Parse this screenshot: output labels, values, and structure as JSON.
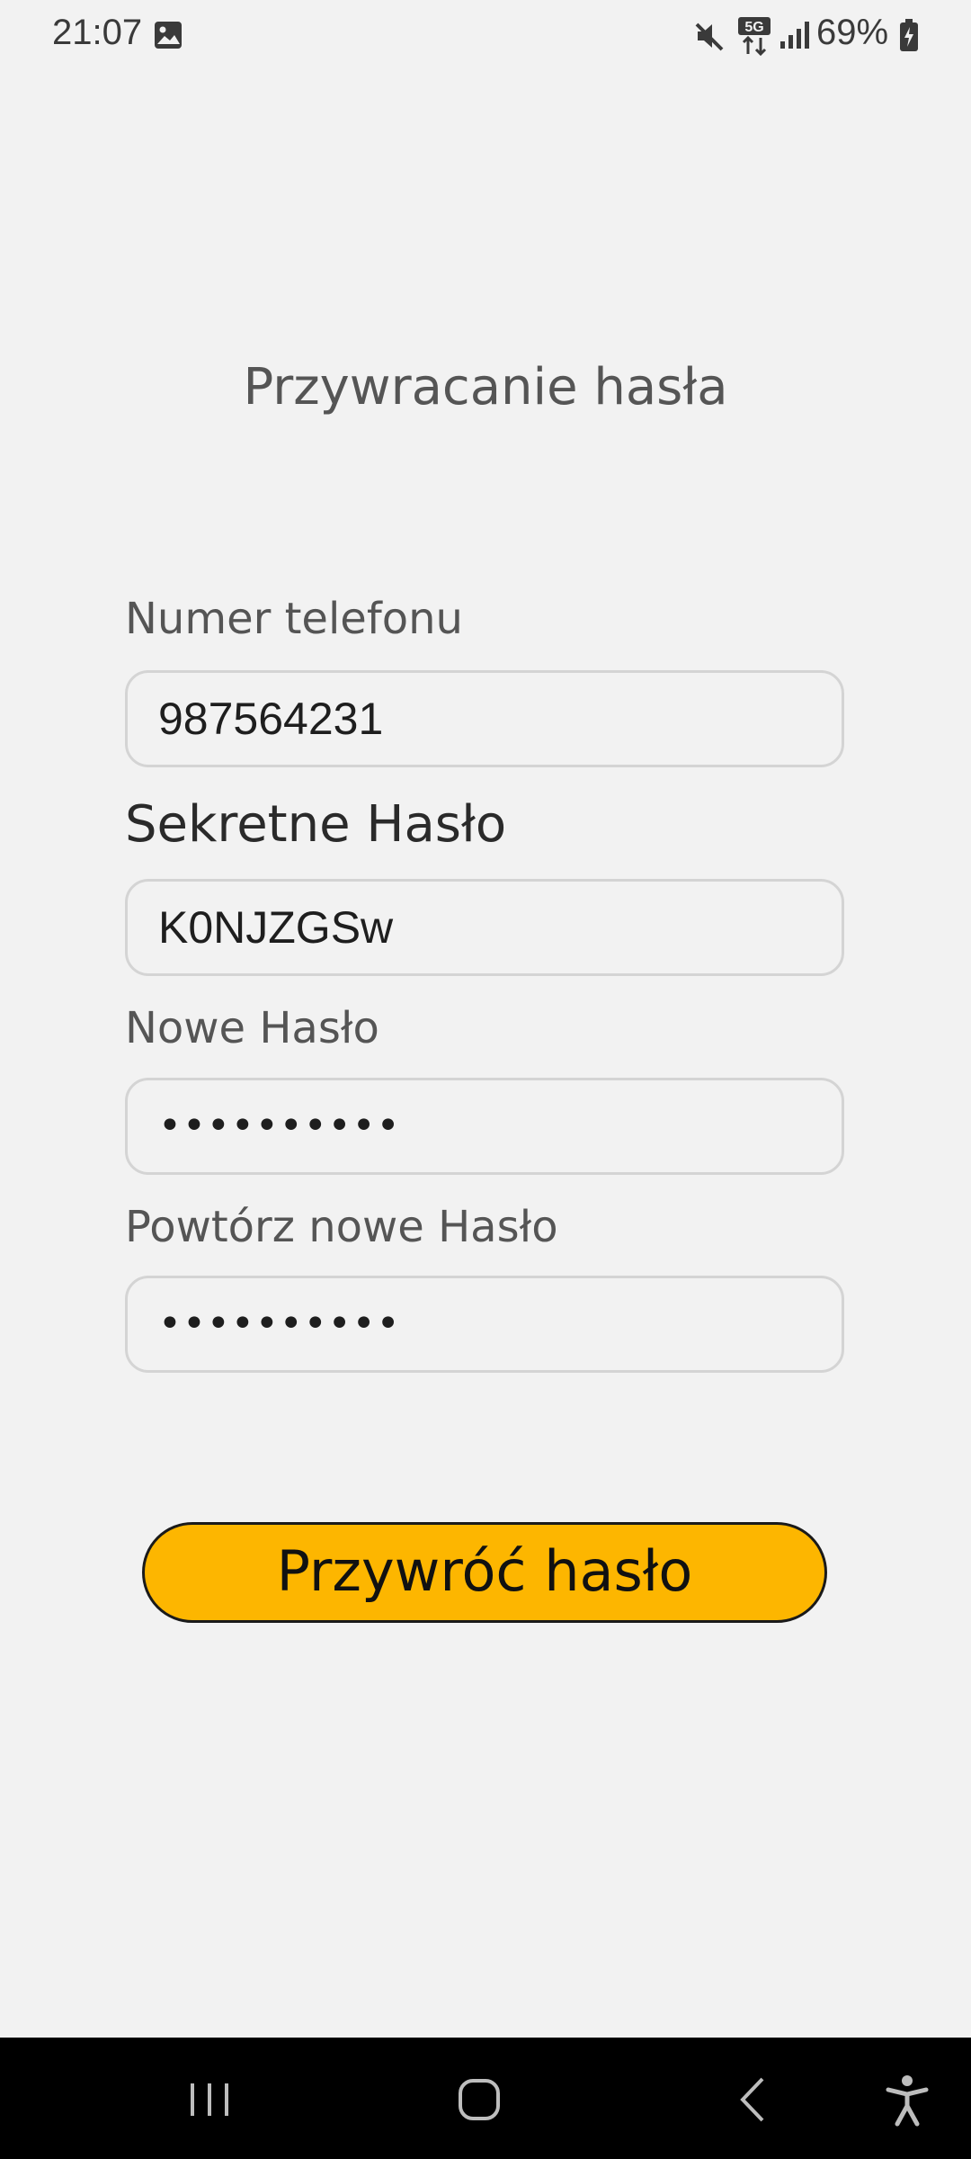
{
  "status_bar": {
    "time": "21:07",
    "battery": "69%",
    "network": "5G",
    "icons": [
      "gallery-icon",
      "mute-icon",
      "5g-data-icon",
      "signal-icon",
      "battery-icon"
    ]
  },
  "title": "Przywracanie hasła",
  "form": {
    "phone": {
      "label": "Numer telefonu",
      "value": "987564231"
    },
    "secret": {
      "label": "Sekretne Hasło",
      "value": "K0NJZGSw"
    },
    "new_password": {
      "label": "Nowe Hasło",
      "value": "••••••••••"
    },
    "repeat_password": {
      "label": "Powtórz nowe Hasło",
      "value": "••••••••••"
    }
  },
  "submit_label": "Przywróć hasło",
  "colors": {
    "background": "#f2f2f2",
    "button": "#fdb600",
    "text_label": "#555555"
  },
  "nav_bar": {
    "icons": [
      "recent-apps-icon",
      "home-icon",
      "back-icon",
      "accessibility-icon"
    ]
  }
}
